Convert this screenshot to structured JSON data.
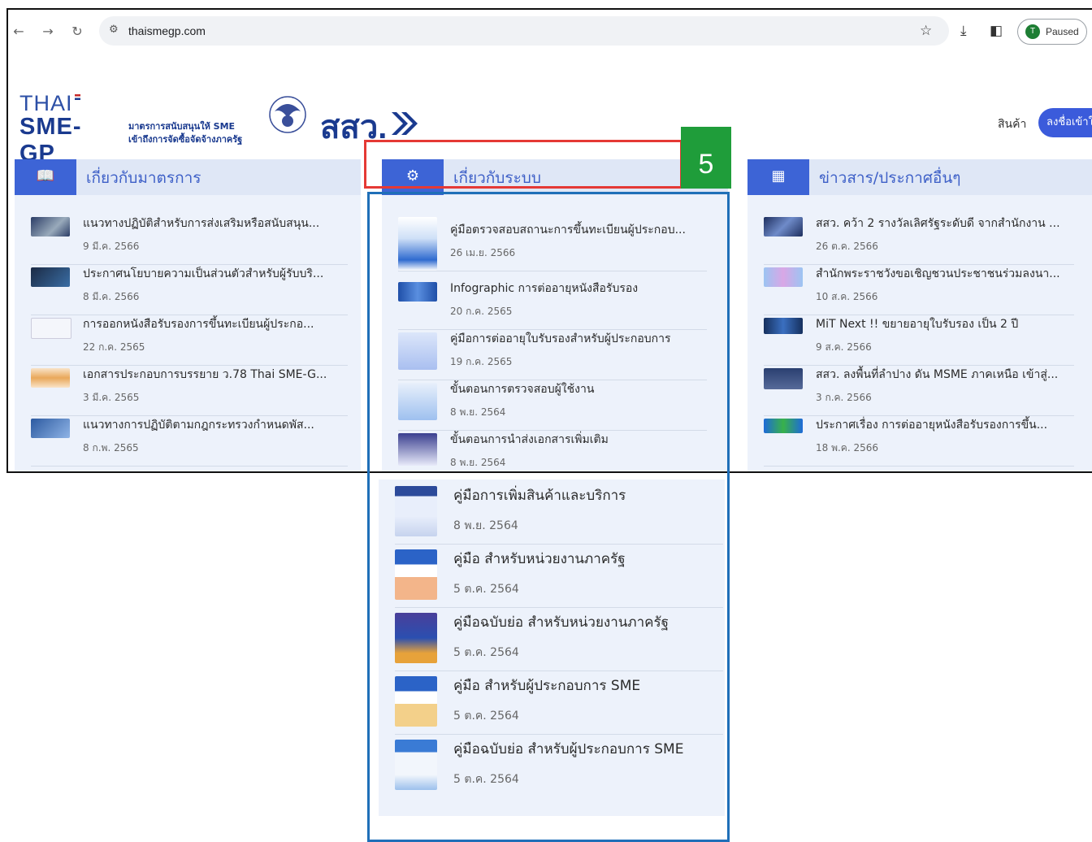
{
  "browser": {
    "url": "thaismegp.com",
    "profile_initial": "T",
    "profile_status": "Paused"
  },
  "header": {
    "logo_thai": "THAI",
    "logo_sme": "SME-GP",
    "logo_tagline_1": "มาตรการสนับสนุนให้ SME",
    "logo_tagline_2": "เข้าถึงการจัดซื้อจัดจ้างภาครัฐ",
    "osmep_logo": "สสว.",
    "nav_products": "สินค้า",
    "login_button": "ลงชื่อเข้าใช้"
  },
  "columns": [
    {
      "title": "เกี่ยวกับมาตรการ",
      "icon": "book-icon",
      "items": [
        {
          "title": "แนวทางปฏิบัติสำหรับการส่งเสริมหรือสนับสนุน...",
          "date": "9 มี.ค. 2566"
        },
        {
          "title": "ประกาศนโยบายความเป็นส่วนตัวสำหรับผู้รับบริ...",
          "date": "8 มี.ค. 2566"
        },
        {
          "title": "การออกหนังสือรับรองการขึ้นทะเบียนผู้ประกอ...",
          "date": "22 ก.ค. 2565"
        },
        {
          "title": "เอกสารประกอบการบรรยาย ว.78 Thai SME-G...",
          "date": "3 มี.ค. 2565"
        },
        {
          "title": "แนวทางการปฏิบัติตามกฎกระทรวงกำหนดพัส...",
          "date": "8 ก.พ. 2565"
        }
      ]
    },
    {
      "title": "เกี่ยวกับระบบ",
      "icon": "gear-icon",
      "items": [
        {
          "title": "คู่มือตรวจสอบสถานะการขึ้นทะเบียนผู้ประกอบ...",
          "date": "26 เม.ย. 2566"
        },
        {
          "title": "Infographic การต่ออายุหนังสือรับรอง",
          "date": "20 ก.ค. 2565"
        },
        {
          "title": "คู่มือการต่ออายุใบรับรองสำหรับผู้ประกอบการ",
          "date": "19 ก.ค. 2565"
        },
        {
          "title": "ขั้นตอนการตรวจสอบผู้ใช้งาน",
          "date": "8 พ.ย. 2564"
        },
        {
          "title": "ขั้นตอนการนำส่งเอกสารเพิ่มเติม",
          "date": "8 พ.ย. 2564"
        }
      ]
    },
    {
      "title": "ข่าวสาร/ประกาศอื่นๆ",
      "icon": "calendar-icon",
      "items": [
        {
          "title": "สสว. คว้า 2 รางวัลเลิศรัฐระดับดี จากสำนักงาน ...",
          "date": "26 ต.ค. 2566"
        },
        {
          "title": "สำนักพระราชวังขอเชิญชวนประชาชนร่วมลงนา...",
          "date": "10 ส.ค. 2566"
        },
        {
          "title": "MiT Next !! ขยายอายุใบรับรอง เป็น 2 ปี",
          "date": "9 ส.ค. 2566"
        },
        {
          "title": "สสว. ลงพื้นที่ลำปาง ดัน MSME ภาคเหนือ เข้าสู่...",
          "date": "3 ก.ค. 2566"
        },
        {
          "title": "ประกาศเรื่อง การต่ออายุหนังสือรับรองการขึ้น...",
          "date": "18 พ.ค. 2566"
        }
      ]
    }
  ],
  "annotation": {
    "step_number": "5"
  },
  "expanded_list": [
    {
      "title": "คู่มือการเพิ่มสินค้าและบริการ",
      "date": "8 พ.ย. 2564"
    },
    {
      "title": "คู่มือ สำหรับหน่วยงานภาครัฐ",
      "date": "5 ต.ค. 2564"
    },
    {
      "title": "คู่มือฉบับย่อ สำหรับหน่วยงานภาครัฐ",
      "date": "5 ต.ค. 2564"
    },
    {
      "title": "คู่มือ สำหรับผู้ประกอบการ SME",
      "date": "5 ต.ค. 2564"
    },
    {
      "title": "คู่มือฉบับย่อ สำหรับผู้ประกอบการ SME",
      "date": "5 ต.ค. 2564"
    }
  ],
  "colors": {
    "accent": "#3d64d6",
    "highlight_red": "#e53935",
    "highlight_blue": "#1f6fb8",
    "badge_green": "#1f9d3a"
  }
}
